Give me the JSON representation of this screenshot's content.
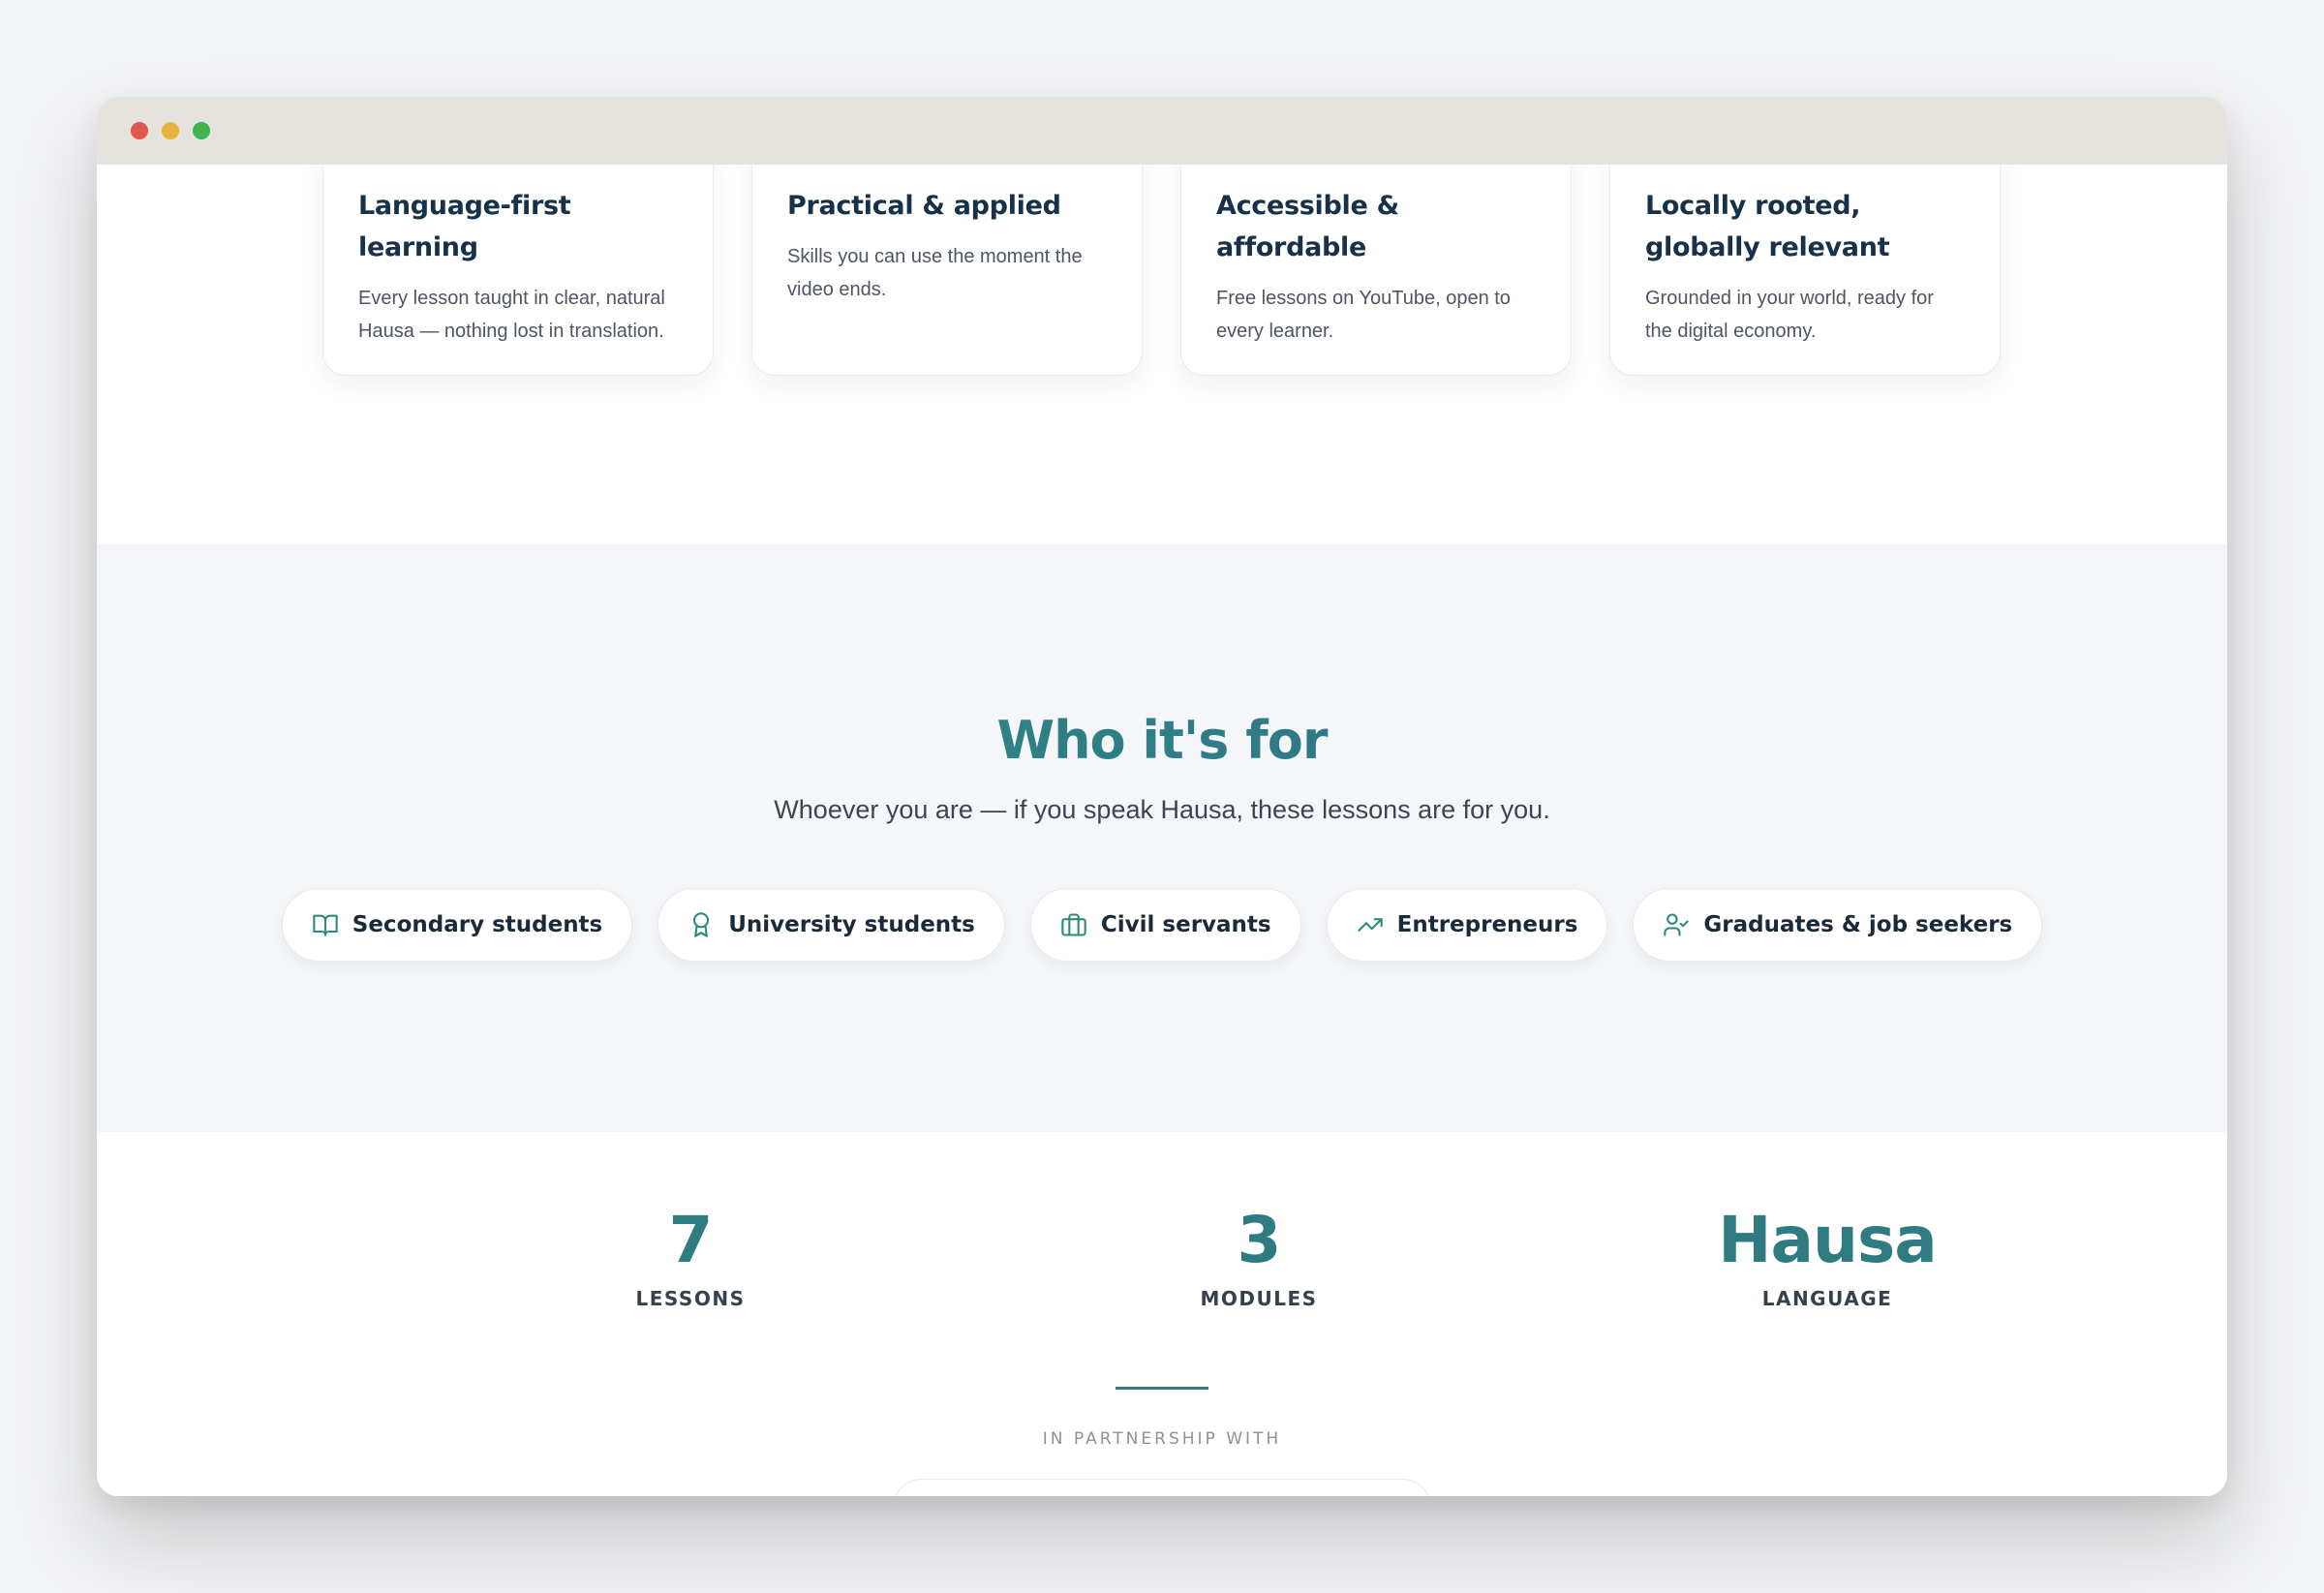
{
  "features": [
    {
      "title": "Language-first learning",
      "description": "Every lesson taught in clear, natural Hausa — nothing lost in translation."
    },
    {
      "title": "Practical & applied",
      "description": "Skills you can use the moment the video ends."
    },
    {
      "title": "Accessible & affordable",
      "description": "Free lessons on YouTube, open to every learner."
    },
    {
      "title": "Locally rooted, globally relevant",
      "description": "Grounded in your world, ready for the digital economy."
    }
  ],
  "audience": {
    "title": "Who it's for",
    "subtitle": "Whoever you are — if you speak Hausa, these lessons are for you.",
    "groups": [
      {
        "label": "Secondary students",
        "icon": "book-open-icon"
      },
      {
        "label": "University students",
        "icon": "award-icon"
      },
      {
        "label": "Civil servants",
        "icon": "briefcase-icon"
      },
      {
        "label": "Entrepreneurs",
        "icon": "trending-up-icon"
      },
      {
        "label": "Graduates & job seekers",
        "icon": "user-check-icon"
      }
    ]
  },
  "stats": [
    {
      "value": "7",
      "label": "LESSONS"
    },
    {
      "value": "3",
      "label": "MODULES"
    },
    {
      "value": "Hausa",
      "label": "LANGUAGE"
    }
  ],
  "partnership": {
    "label": "IN PARTNERSHIP WITH"
  },
  "colors": {
    "accent": "#2e7c82",
    "heading_gradient_start": "#2c9a78",
    "heading_gradient_end": "#33668f",
    "icon": "#2f8a7a"
  }
}
